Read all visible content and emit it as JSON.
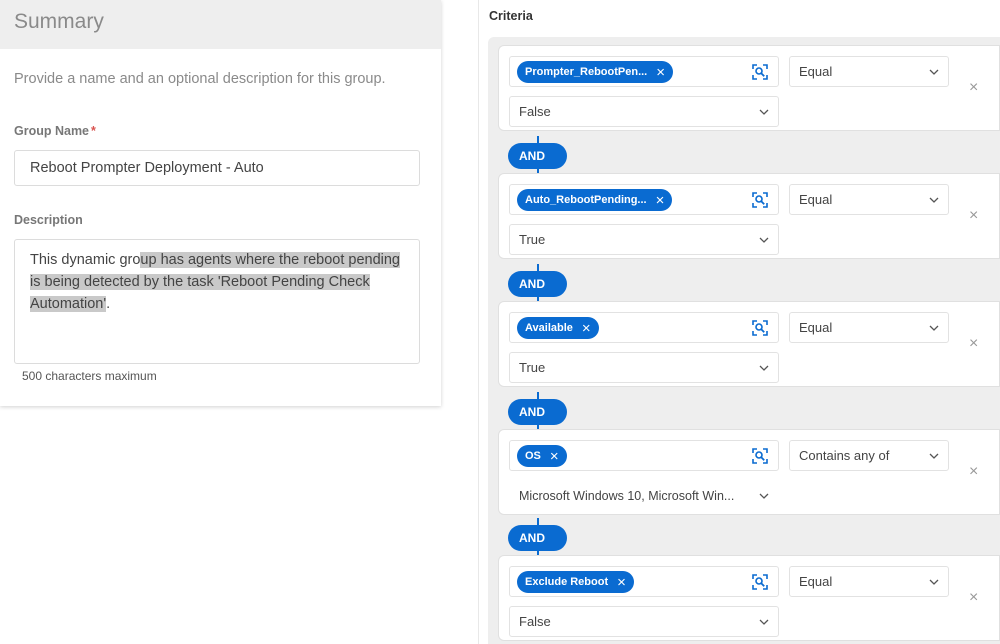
{
  "summary": {
    "title": "Summary",
    "intro": "Provide a name and an optional description for this group.",
    "group_name_label": "Group Name",
    "required_mark": "*",
    "group_name_value": "Reboot Prompter Deployment - Auto",
    "description_label": "Description",
    "description_pre": "This dynamic gro",
    "description_sel": "up has agents where the reboot pending is being detected by the task 'Reboot Pending Check Automation'",
    "description_post": ".",
    "char_hint": "500 characters maximum"
  },
  "criteria": {
    "label": "Criteria",
    "and_label": "AND",
    "remove_glyph": "×",
    "rows": [
      {
        "field": "Prompter_RebootPen...",
        "operator": "Equal",
        "value": "False"
      },
      {
        "field": "Auto_RebootPending...",
        "operator": "Equal",
        "value": "True"
      },
      {
        "field": "Available",
        "operator": "Equal",
        "value": "True"
      },
      {
        "field": "OS",
        "operator": "Contains any of",
        "value": "Microsoft Windows 10, Microsoft Win..."
      },
      {
        "field": "Exclude Reboot",
        "operator": "Equal",
        "value": "False"
      }
    ]
  },
  "colors": {
    "accent": "#0a6bd1",
    "panel_bg": "#eeeeee"
  }
}
